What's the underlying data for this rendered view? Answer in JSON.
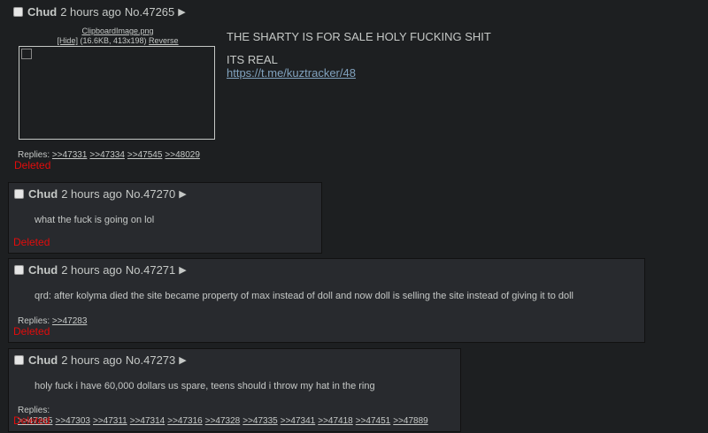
{
  "op": {
    "name": "Chud",
    "date": "2 hours ago",
    "post_no": "No.47265",
    "file_name": "ClipboardImage.png",
    "hide_label": "[Hide]",
    "file_meta": "(16.6KB, 413x198)",
    "reverse_label": "Reverse",
    "lines": [
      "THE SHARTY IS FOR SALE HOLY FUCKING SHIT",
      "ITS REAL"
    ],
    "link": "https://t.me/kuztracker/48",
    "replies_label": "Replies:",
    "replies": [
      ">>47331",
      ">>47334",
      ">>47545",
      ">>48029"
    ],
    "status": "Deleted"
  },
  "posts": [
    {
      "name": "Chud",
      "date": "2 hours ago",
      "post_no": "No.47270",
      "message": "what the fuck is going on lol",
      "replies_label": "",
      "replies": [],
      "status": "Deleted"
    },
    {
      "name": "Chud",
      "date": "2 hours ago",
      "post_no": "No.47271",
      "message": "qrd: after kolyma died the site became property of max instead of doll  and now doll is selling the site instead of giving it to doll",
      "replies_label": "Replies:",
      "replies": [
        ">>47283"
      ],
      "status": "Deleted"
    },
    {
      "name": "Chud",
      "date": "2 hours ago",
      "post_no": "No.47273",
      "message": "holy fuck i have 60,000 dollars us spare, teens should i throw my hat in the ring",
      "replies_label": "Replies:",
      "replies": [
        ">>47285",
        ">>47303",
        ">>47311",
        ">>47314",
        ">>47316",
        ">>47328",
        ">>47335",
        ">>47341",
        ">>47418",
        ">>47451",
        ">>47889"
      ],
      "status": "Deleted"
    }
  ]
}
